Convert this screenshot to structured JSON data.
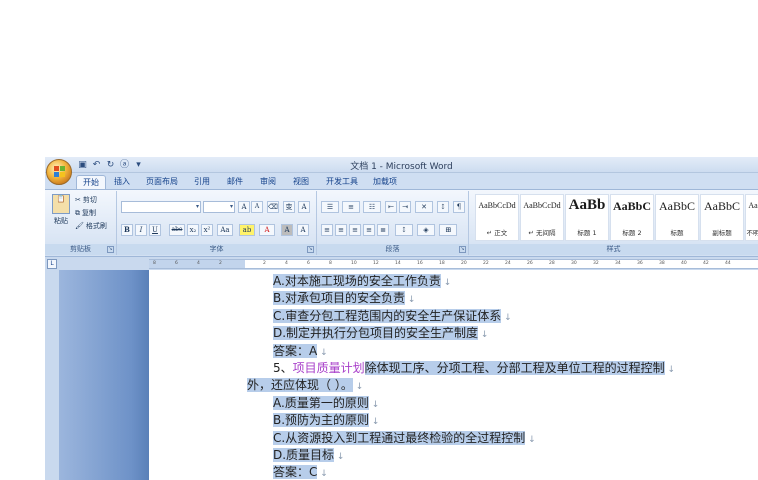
{
  "window": {
    "title": "文档 1 - Microsoft Word"
  },
  "quick_access": [
    "save-icon",
    "undo-icon",
    "redo-icon",
    "format-icon",
    "dropdown-icon"
  ],
  "tabs": [
    "开始",
    "插入",
    "页面布局",
    "引用",
    "邮件",
    "审阅",
    "视图",
    "开发工具",
    "加载项"
  ],
  "clipboard": {
    "paste": "粘贴",
    "cut": "剪切",
    "copy": "复制",
    "format_painter": "格式刷",
    "label": "剪贴板"
  },
  "font": {
    "name_value": "",
    "size_value": "",
    "label": "字体",
    "bold": "B",
    "italic": "I",
    "underline": "U",
    "strike": "abe",
    "sub": "x₂",
    "sup": "x²",
    "case": "Aa",
    "grow": "A",
    "shrink": "A",
    "clear": "A",
    "phonetic": "变",
    "border": "A",
    "highlight": "ab",
    "color": "A",
    "shade": "A"
  },
  "paragraph": {
    "label": "段落"
  },
  "styles": {
    "label": "样式",
    "items": [
      {
        "sample": "AaBbCcDd",
        "name": "↵ 正文"
      },
      {
        "sample": "AaBbCcDd",
        "name": "↵ 无间隔"
      },
      {
        "sample": "AaBb",
        "name": "标题 1"
      },
      {
        "sample": "AaBbC",
        "name": "标题 2"
      },
      {
        "sample": "AaBbC",
        "name": "标题"
      },
      {
        "sample": "AaBbC",
        "name": "副标题"
      },
      {
        "sample": "Aa",
        "name": "不明"
      }
    ]
  },
  "ruler": {
    "ticks": [
      "8",
      "6",
      "4",
      "2",
      "",
      "2",
      "4",
      "6",
      "8",
      "10",
      "12",
      "14",
      "16",
      "18",
      "20",
      "22",
      "24",
      "26",
      "28",
      "30",
      "32",
      "34",
      "36",
      "38",
      "40",
      "42",
      "44"
    ]
  },
  "document": {
    "lines": [
      {
        "indent": 1,
        "text": "A.对本施工现场的安全工作负责"
      },
      {
        "indent": 1,
        "text": "B.对承包项目的安全负责"
      },
      {
        "indent": 1,
        "text": "C.审查分包工程范围内的安全生产保证体系"
      },
      {
        "indent": 1,
        "text": "D.制定并执行分包项目的安全生产制度"
      },
      {
        "indent": 1,
        "text": "答案：A"
      },
      {
        "indent": 1,
        "prefix": "5、",
        "highlight": "项目质量计划",
        "text": "除体现工序、分项工程、分部工程及单位工程的过程控制"
      },
      {
        "indent": 0,
        "text": "外，还应体现（ ）。"
      },
      {
        "indent": 1,
        "text": "A.质量第一的原则"
      },
      {
        "indent": 1,
        "text": "B.预防为主的原则"
      },
      {
        "indent": 1,
        "text": "C.从资源投入到工程通过最终检验的全过程控制"
      },
      {
        "indent": 1,
        "text": "D.质量目标"
      },
      {
        "indent": 1,
        "text": "答案：C"
      }
    ],
    "para_mark": "↓"
  }
}
